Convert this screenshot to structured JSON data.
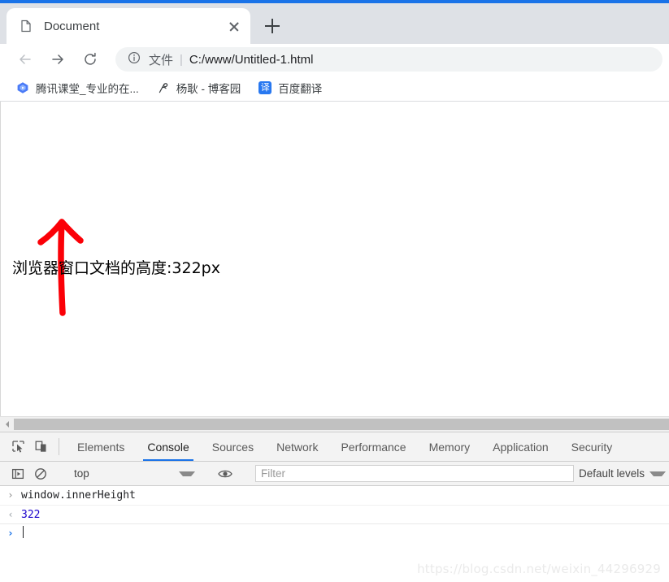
{
  "browser": {
    "accent_color": "#1a73e8",
    "tab": {
      "title": "Document",
      "favicon": "document-icon",
      "close_icon": "close-icon"
    },
    "new_tab_label": "+",
    "toolbar": {
      "back_icon": "back-arrow-icon",
      "forward_icon": "forward-arrow-icon",
      "reload_icon": "reload-icon",
      "omnibox": {
        "info_icon": "info-circle-icon",
        "scheme_label": "文件",
        "separator": "|",
        "url": "C:/www/Untitled-1.html"
      }
    },
    "bookmarks": [
      {
        "label": "腾讯课堂_专业的在...",
        "icon": "tencent-classroom-icon"
      },
      {
        "label": "杨耿 - 博客园",
        "icon": "cnblogs-icon"
      },
      {
        "label": "百度翻译",
        "icon": "translate-icon",
        "icon_glyph": "译"
      }
    ]
  },
  "page": {
    "text": "浏览器窗口文档的高度:322px",
    "annotations": [
      {
        "name": "arrow-up",
        "color": "#fb0007",
        "direction": "up"
      },
      {
        "name": "arrow-down",
        "color": "#fb0007",
        "direction": "down"
      }
    ],
    "scrollbar": {
      "left_arrow_icon": "scroll-left-arrow-icon",
      "orientation": "horizontal"
    }
  },
  "devtools": {
    "inspect_icon": "inspect-element-icon",
    "device_icon": "device-toolbar-icon",
    "tabs": [
      {
        "label": "Elements",
        "active": false
      },
      {
        "label": "Console",
        "active": true
      },
      {
        "label": "Sources",
        "active": false
      },
      {
        "label": "Network",
        "active": false
      },
      {
        "label": "Performance",
        "active": false
      },
      {
        "label": "Memory",
        "active": false
      },
      {
        "label": "Application",
        "active": false
      },
      {
        "label": "Security",
        "active": false
      }
    ],
    "console_toolbar": {
      "sidebar_icon": "console-sidebar-icon",
      "clear_icon": "clear-console-icon",
      "context_value": "top",
      "eye_icon": "live-expression-icon",
      "filter_placeholder": "Filter",
      "levels_label": "Default levels"
    },
    "console_entries": [
      {
        "type": "input",
        "gutter": "›",
        "text": "window.innerHeight"
      },
      {
        "type": "output",
        "gutter": "‹",
        "text": "322"
      },
      {
        "type": "prompt",
        "gutter": "›",
        "text": ""
      }
    ]
  },
  "watermark": "https://blog.csdn.net/weixin_44296929"
}
